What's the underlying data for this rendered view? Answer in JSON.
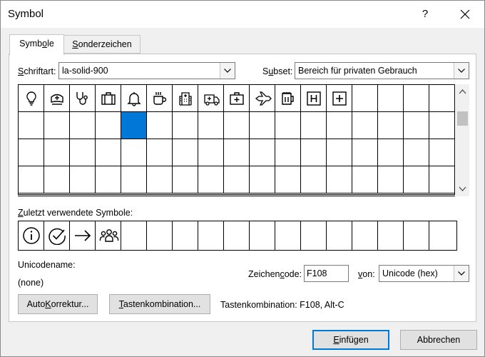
{
  "window": {
    "title": "Symbol",
    "help_label": "?"
  },
  "tabs": [
    {
      "label": "Symbole",
      "mnemonic_index": 4,
      "active": true
    },
    {
      "label": "Sonderzeichen",
      "mnemonic_index": 0,
      "active": false
    }
  ],
  "font": {
    "label": "Schriftart:",
    "value": "la-solid-900"
  },
  "subset": {
    "label": "Subset:",
    "value": "Bereich für privaten Gebrauch"
  },
  "symbol_grid": {
    "row1_icons": [
      "lightbulb-icon",
      "medical-cap-icon",
      "stethoscope-icon",
      "briefcase-icon",
      "bell-icon",
      "coffee-mug-icon",
      "hospital-building-icon",
      "ambulance-icon",
      "first-aid-kit-icon",
      "fighter-jet-icon",
      "beer-mug-icon",
      "h-square-icon",
      "plus-square-icon"
    ],
    "selected_row": 1,
    "selected_col": 4
  },
  "recent": {
    "label": "Zuletzt verwendete Symbole:",
    "icons": [
      "info-circle-icon",
      "check-circle-icon",
      "arrow-right-icon",
      "users-group-icon"
    ]
  },
  "unicode_name": {
    "label": "Unicodename:",
    "value": "(none)"
  },
  "char_code": {
    "label": "Zeichencode:",
    "value": "F108"
  },
  "from": {
    "label": "von:",
    "value": "Unicode (hex)"
  },
  "buttons": {
    "autocorrect": "AutoKorrektur...",
    "shortcut_key": "Tastenkombination...",
    "insert": "Einfügen",
    "cancel": "Abbrechen"
  },
  "shortcut_info": "Tastenkombination: F108, Alt-C",
  "colors": {
    "selection": "#0078d7",
    "default_button_border": "#0078d7"
  }
}
